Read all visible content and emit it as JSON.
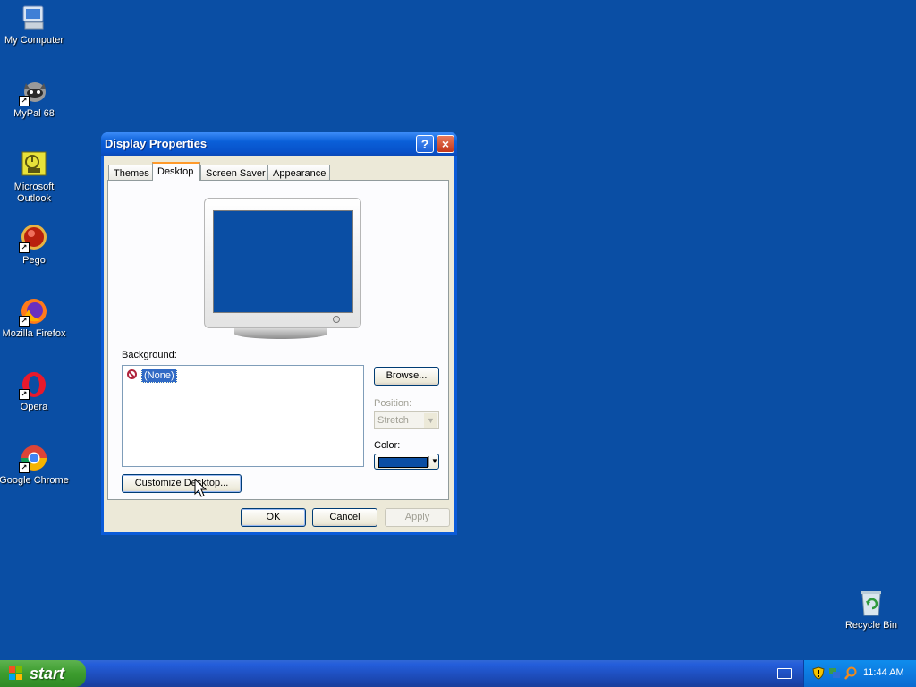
{
  "desktop": {
    "background_color": "#0a4ea4",
    "icons": [
      {
        "label": "My Computer",
        "icon": "computer-icon"
      },
      {
        "label": "MyPal 68",
        "icon": "mypal-icon"
      },
      {
        "label": "Microsoft\nOutlook",
        "icon": "outlook-icon"
      },
      {
        "label": "Pego",
        "icon": "pego-icon"
      },
      {
        "label": "Mozilla Firefox",
        "icon": "firefox-icon"
      },
      {
        "label": "Opera",
        "icon": "opera-icon"
      },
      {
        "label": "Google Chrome",
        "icon": "chrome-icon"
      },
      {
        "label": "Recycle Bin",
        "icon": "recycle-bin-icon"
      }
    ]
  },
  "dialog": {
    "title": "Display Properties",
    "help_button": "?",
    "close_button": "×",
    "tabs": [
      {
        "label": "Themes",
        "active": false
      },
      {
        "label": "Desktop",
        "active": true
      },
      {
        "label": "Screen Saver",
        "active": false
      },
      {
        "label": "Appearance",
        "active": false
      }
    ],
    "background_label": "Background:",
    "background_items": [
      {
        "label": "(None)",
        "selected": true
      }
    ],
    "browse_button": "Browse...",
    "position_label": "Position:",
    "position_value": "Stretch",
    "color_label": "Color:",
    "color_value": "#0a4ea4",
    "customize_button": "Customize Desktop...",
    "ok_button": "OK",
    "cancel_button": "Cancel",
    "apply_button": "Apply"
  },
  "taskbar": {
    "start_label": "start",
    "clock": "11:44 AM"
  }
}
